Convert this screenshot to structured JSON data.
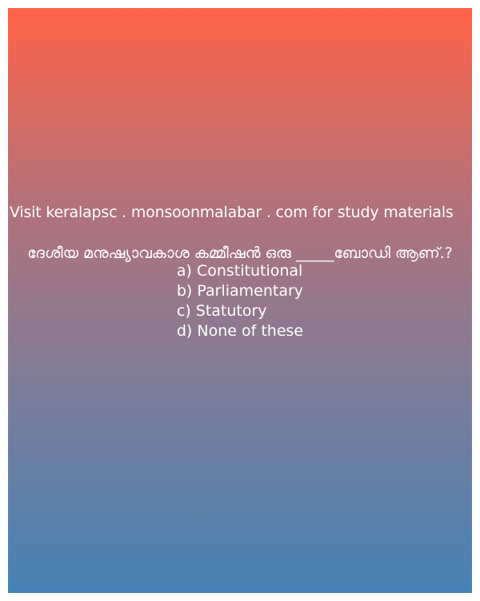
{
  "promo_text": "Visit keralapsc . monsoonmalabar . com for study materials",
  "question": "ദേശീയ മനുഷ്യാവകാശ കമ്മീഷൻ ഒരു _____ബോഡി ആണ്.?",
  "options": [
    "a) Constitutional",
    "b) Parliamentary",
    "c) Statutory",
    "d) None of these"
  ],
  "colors": {
    "gradient_top": "#ff6347",
    "gradient_bottom": "#4682b4",
    "text": "#ffffff"
  }
}
